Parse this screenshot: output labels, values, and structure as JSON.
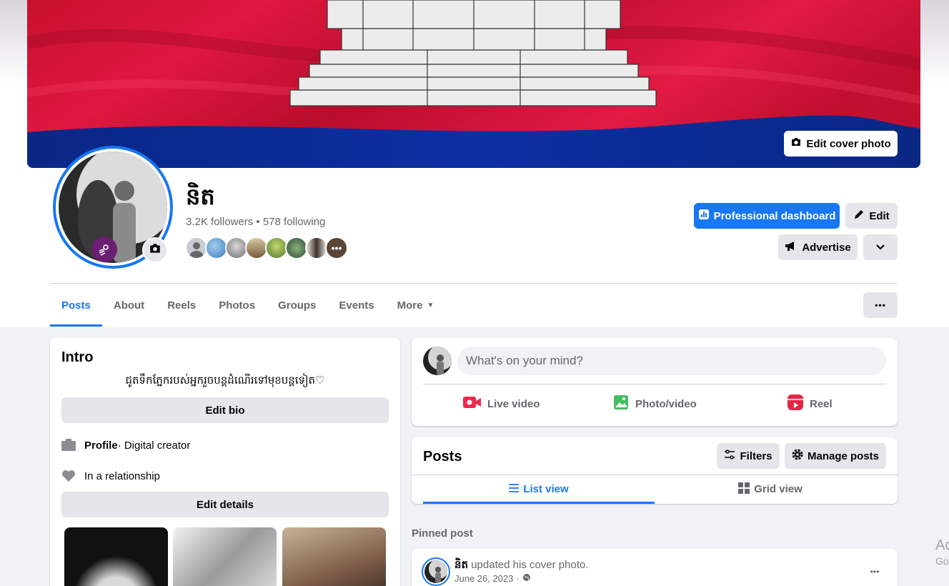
{
  "profile": {
    "name": "និត",
    "followers": "3.2K followers",
    "separator": "•",
    "following": "578 following"
  },
  "cover": {
    "edit_label": "Edit cover photo",
    "flag_colors": {
      "red": "#e0173f",
      "blue": "#0b2a9a"
    }
  },
  "header_buttons": {
    "professional_dashboard": "Professional dashboard",
    "edit": "Edit",
    "advertise": "Advertise"
  },
  "tabs": [
    {
      "label": "Posts"
    },
    {
      "label": "About"
    },
    {
      "label": "Reels"
    },
    {
      "label": "Photos"
    },
    {
      "label": "Groups"
    },
    {
      "label": "Events"
    },
    {
      "label": "More"
    }
  ],
  "intro": {
    "title": "Intro",
    "bio": "ជូតទឹកភ្នែករបស់អ្នករួចបន្តដំណើរទៅមុខបន្តទៀត♡",
    "edit_bio": "Edit bio",
    "profile_label": "Profile",
    "profile_category": " · Digital creator",
    "relationship": "In a relationship",
    "edit_details": "Edit details"
  },
  "composer": {
    "placeholder": "What's on your mind?",
    "live_video": "Live video",
    "photo_video": "Photo/video",
    "reel": "Reel"
  },
  "posts": {
    "title": "Posts",
    "filters": "Filters",
    "manage": "Manage posts",
    "list_view": "List view",
    "grid_view": "Grid view",
    "pinned_label": "Pinned post"
  },
  "pinned_post": {
    "author": "និត",
    "action": " updated his cover photo.",
    "date": "June 26, 2023",
    "separator": "·"
  },
  "watermark": {
    "line1": "Ac",
    "line2": "Go"
  },
  "colors": {
    "accent": "#1877f2",
    "button_grey": "#e4e6eb",
    "page_bg": "#f0f2f5",
    "live_red": "#f02849",
    "photo_green": "#45bd62",
    "reel_red": "#e42645"
  },
  "icons": [
    "camera-icon",
    "dashboard-icon",
    "pencil-icon",
    "megaphone-icon",
    "chevron-down-icon",
    "ellipsis-icon",
    "caret-down-icon",
    "briefcase-icon",
    "heart-icon",
    "live-video-icon",
    "photo-icon",
    "reel-icon",
    "filters-icon",
    "gear-icon",
    "list-icon",
    "grid-icon",
    "globe-icon",
    "professional-badge-icon"
  ]
}
